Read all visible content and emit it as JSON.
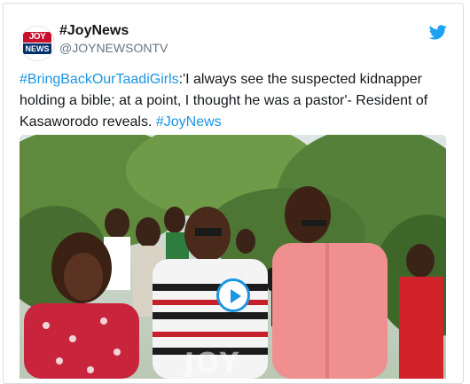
{
  "account": {
    "name": "#JoyNews",
    "handle": "@JOYNEWSONTV",
    "avatar_top": "JOY",
    "avatar_bottom": "NEWS"
  },
  "tweet": {
    "hashtag_lead": "#BringBackOurTaadiGirls",
    "body": ":'I always see the suspected kidnapper holding a bible; at a point, I thought he was a pastor'-  Resident of Kasaworodo reveals. ",
    "hashtag_tail": "#JoyNews"
  },
  "media": {
    "watermark": "JOY",
    "play_icon": "play-icon"
  },
  "icons": {
    "brand": "twitter-bird-icon"
  },
  "colors": {
    "link": "#1b95e0",
    "text": "#14171a",
    "muted": "#657786"
  }
}
